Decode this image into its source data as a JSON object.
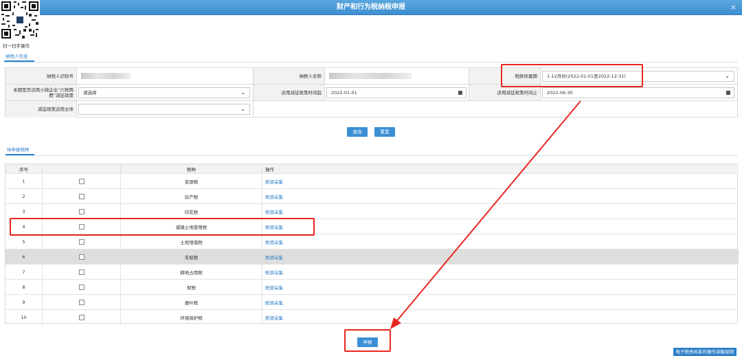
{
  "window": {
    "title": "财产和行为税纳税申报",
    "close": "×"
  },
  "qr": {
    "label": "扫一扫手操作"
  },
  "tabs": {
    "taxpayer_info": "纳税人信息",
    "pending": "待申报税种"
  },
  "form": {
    "taxpayer_id_label": "纳税人识别号",
    "taxpayer_name_label": "纳税人名称",
    "period_label": "税款所属期",
    "period_value": "1-12月份(2022-01-01至2022-12-31)",
    "small_biz_label": "本期是否适用小微企业“六税两费”减征政策",
    "small_biz_value": "请选择",
    "start_label": "适用减征政策时间起",
    "start_value": "2022-01-01",
    "end_label": "适用减征政策时间止",
    "end_value": "2022-06-30",
    "subject_label": "减征政策适用主体",
    "subject_value": ""
  },
  "buttons": {
    "query": "查询",
    "reset": "重置",
    "submit": "申报",
    "video": "电子税务局系列操作讲解视频"
  },
  "table": {
    "headers": [
      "序号",
      "",
      "税种",
      "操作"
    ],
    "rows": [
      {
        "no": "1",
        "tax": "资源税",
        "action": "税源采集"
      },
      {
        "no": "2",
        "tax": "房产税",
        "action": "税源采集"
      },
      {
        "no": "3",
        "tax": "印花税",
        "action": "税源采集"
      },
      {
        "no": "4",
        "tax": "城镇土地使用税",
        "action": "税源采集"
      },
      {
        "no": "5",
        "tax": "土地增值税",
        "action": "税源采集"
      },
      {
        "no": "6",
        "tax": "车船税",
        "action": "税源采集"
      },
      {
        "no": "7",
        "tax": "耕地占用税",
        "action": "税源采集"
      },
      {
        "no": "8",
        "tax": "契税",
        "action": "税源采集"
      },
      {
        "no": "9",
        "tax": "烟叶税",
        "action": "税源采集"
      },
      {
        "no": "10",
        "tax": "环境保护税",
        "action": "税源采集"
      }
    ]
  },
  "colors": {
    "accent": "#2f80c8",
    "highlight": "#e8261f"
  }
}
